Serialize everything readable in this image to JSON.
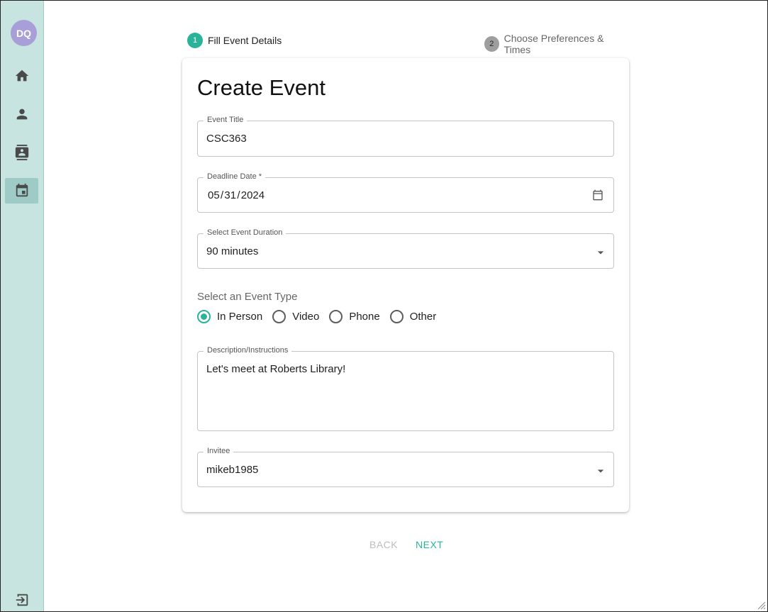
{
  "sidebar": {
    "avatar_initials": "DQ",
    "avatar_color": "#a89fd8",
    "nav": [
      {
        "icon": "home-icon",
        "active": false
      },
      {
        "icon": "person-icon",
        "active": false
      },
      {
        "icon": "contacts-icon",
        "active": false
      },
      {
        "icon": "calendar-icon",
        "active": true
      }
    ],
    "logout_icon": "logout-icon"
  },
  "stepper": {
    "steps": [
      {
        "number": "1",
        "label": "Fill Event Details",
        "active": true
      },
      {
        "number": "2",
        "label": "Choose Preferences & Times",
        "active": false
      }
    ],
    "active_color": "#2bb39a",
    "inactive_color": "#9e9e9e"
  },
  "form": {
    "title": "Create Event",
    "event_title": {
      "label": "Event Title",
      "value": "CSC363"
    },
    "deadline": {
      "label": "Deadline Date *",
      "month": "05",
      "day": "31",
      "year": "2024"
    },
    "duration": {
      "label": "Select Event Duration",
      "value": "90 minutes"
    },
    "event_type": {
      "heading": "Select an Event Type",
      "options": [
        "In Person",
        "Video",
        "Phone",
        "Other"
      ],
      "selected": "In Person"
    },
    "description": {
      "label": "Description/Instructions",
      "value": "Let's meet at Roberts Library!"
    },
    "invitee": {
      "label": "Invitee",
      "value": "mikeb1985"
    }
  },
  "footer": {
    "back_label": "BACK",
    "next_label": "NEXT",
    "accent_color": "#2bb39a",
    "disabled_color": "#bdbdbd"
  }
}
